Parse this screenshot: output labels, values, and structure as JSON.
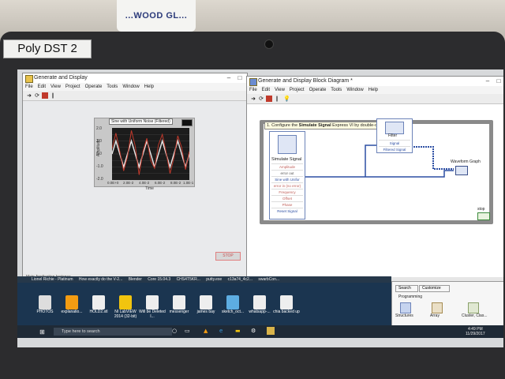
{
  "sticker_label": "Poly DST 2",
  "bucket_text": "...WOOD GL...",
  "front_panel": {
    "title": "Generate and Display",
    "menu": [
      "File",
      "Edit",
      "View",
      "Project",
      "Operate",
      "Tools",
      "Window",
      "Help"
    ],
    "graph_label": "Sine with Uniform Noise (Filtered)",
    "y_axis_label": "Amplitude",
    "x_axis_label": "Time",
    "y_ticks": [
      "2.0",
      "1.5",
      "1.0",
      "0.5",
      "0.0",
      "-0.5",
      "-1.0",
      "-1.5",
      "-2.0"
    ],
    "x_ticks": [
      "0.0E+0",
      "2.0E-2",
      "4.0E-2",
      "6.0E-2",
      "8.0E-2",
      "1.0E-1"
    ],
    "stop_label": "STOP",
    "status": "Main Application Instance"
  },
  "block_diagram": {
    "title": "Generate and Display Block Diagram *",
    "menu": [
      "File",
      "Edit",
      "View",
      "Project",
      "Operate",
      "Tools",
      "Window",
      "Help"
    ],
    "comment_prefix": "1. Configure the ",
    "comment_bold": "Simulate Signal",
    "comment_suffix": " Express VI by double-clicking it.",
    "simulate_signal": {
      "title": "Simulate Signal",
      "rows": [
        "Amplitude",
        "error out",
        "Sine with Unifor",
        "error in (no error)",
        "Frequency",
        "Offset",
        "Phase",
        "Reset Signal"
      ]
    },
    "filter": {
      "title": "Filter",
      "rows": [
        "Signal",
        "Filtered Signal"
      ]
    },
    "waveform_graph_label": "Waveform Graph",
    "stop_label": "stop",
    "status": "Main Application Instance"
  },
  "taskbar_apps": [
    "Lionel Richie - Platinum",
    "How exactly do the V-2...",
    "Blender",
    "Core 15.04.3",
    "CHS4T5KR...",
    "putty.exe",
    "c13a74_4c2...",
    "swarbCon..."
  ],
  "desktop_icons": [
    "PHOTOS",
    "explanatio...",
    "HOLD2.stl",
    "NI LabVIEW 2014 (32-bit)",
    "Will be Deleted I...",
    "messenger",
    "james bay",
    "sketch_oct...",
    "whatsapp-...",
    "chia backed up"
  ],
  "search_placeholder": "Type here to search",
  "clock": {
    "time": "4:49 PM",
    "date": "11/29/2017"
  },
  "palette": {
    "search": "Search",
    "customize": "Customize",
    "section": "Programming",
    "items": [
      "Structures",
      "Array",
      "Cluster, Clas..."
    ]
  },
  "colors": {
    "trace_sine": "#e8e8e8",
    "trace_noise": "#c0392b",
    "wire_blue": "#2c4ea3",
    "taskbar": "#1f2a36"
  },
  "chart_data": {
    "type": "line",
    "title": "Sine with Uniform Noise (Filtered)",
    "xlabel": "Time",
    "ylabel": "Amplitude",
    "xlim": [
      0,
      0.1
    ],
    "ylim": [
      -2,
      2
    ],
    "grid": true,
    "series": [
      {
        "x": [
          0,
          0.005,
          0.01,
          0.015,
          0.02,
          0.025,
          0.03,
          0.035,
          0.04,
          0.045,
          0.05,
          0.055,
          0.06,
          0.065,
          0.07,
          0.075,
          0.08,
          0.085,
          0.09,
          0.095,
          0.1
        ],
        "y": [
          0,
          1,
          0,
          -1,
          0,
          1,
          0,
          -1,
          0,
          1,
          0,
          -1,
          0,
          1,
          0,
          -1,
          0,
          1,
          0,
          -1,
          0
        ]
      },
      {
        "x": [
          0,
          0.005,
          0.01,
          0.015,
          0.02,
          0.025,
          0.03,
          0.035,
          0.04,
          0.045,
          0.05,
          0.055,
          0.06,
          0.065,
          0.07,
          0.075,
          0.08,
          0.085,
          0.09,
          0.095,
          0.1
        ],
        "y": [
          0.4,
          1.6,
          0.2,
          -1.3,
          -0.2,
          1.8,
          0.6,
          -1.6,
          0.2,
          1.2,
          -0.5,
          -1.1,
          0.7,
          1.5,
          0.1,
          -1.5,
          -0.3,
          1.4,
          0.5,
          -1.2,
          0.2
        ]
      }
    ]
  }
}
